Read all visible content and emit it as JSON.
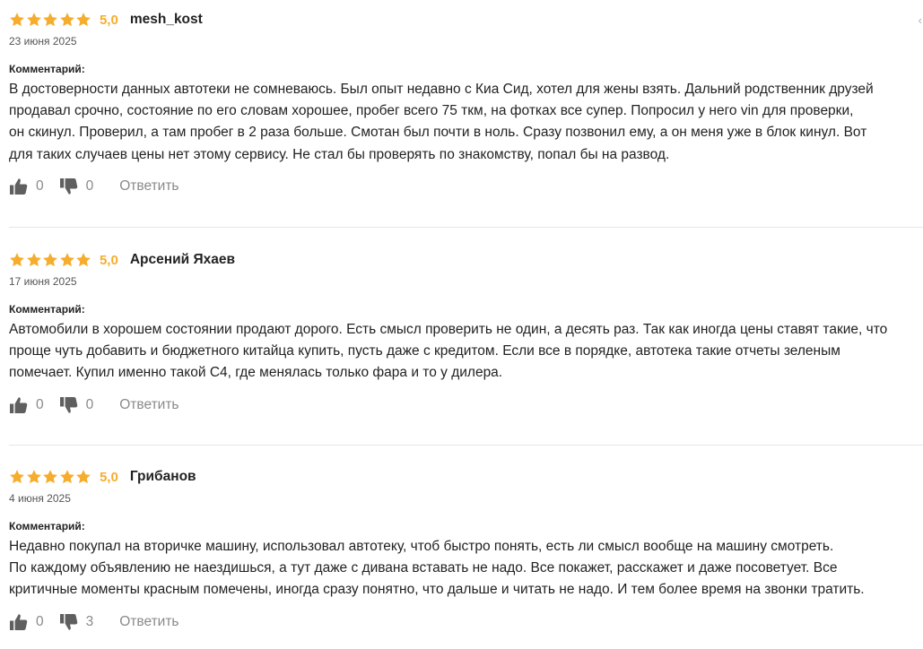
{
  "collapse_icon_glyph": "‹",
  "comment_label": "Комментарий:",
  "reply_label": "Ответить",
  "colors": {
    "star": "#f6ad2e",
    "score": "#f6ad2e",
    "muted": "#8a8a8a",
    "icon": "#5f5f5f"
  },
  "reviews": [
    {
      "rating": "5,0",
      "stars": 5,
      "author": "mesh_kost",
      "date": "23 июня 2025",
      "lines": [
        "В достоверности данных автотеки не сомневаюсь. Был опыт недавно с Киа Сид, хотел для жены взять. Дальний родственник друзей",
        "продавал срочно, состояние по его словам хорошее, пробег всего 75 ткм, на фотках все супер. Попросил у него vin для проверки,",
        "он скинул. Проверил, а там пробег в 2 раза больше. Смотан был почти в ноль. Сразу позвонил ему, а он меня уже в блок кинул. Вот",
        "для таких случаев цены нет этому сервису. Не стал бы проверять по знакомству, попал бы на развод."
      ],
      "likes": "0",
      "dislikes": "0"
    },
    {
      "rating": "5,0",
      "stars": 5,
      "author": "Арсений Яхаев",
      "date": "17 июня 2025",
      "lines": [
        "Автомобили в хорошем состоянии продают дорого. Есть смысл проверить не один, а десять раз. Так как иногда цены ставят такие, что",
        "проще чуть добавить и бюджетного китайца купить, пусть даже с кредитом. Если все в порядке, автотека такие отчеты зеленым",
        "помечает. Купил именно такой С4, где менялась только фара и то у дилера."
      ],
      "likes": "0",
      "dislikes": "0"
    },
    {
      "rating": "5,0",
      "stars": 5,
      "author": "Грибанов",
      "date": "4 июня 2025",
      "lines": [
        "Недавно покупал на вторичке машину, использовал автотеку, чтоб быстро понять, есть ли смысл вообще на машину смотреть.",
        "По каждому объявлению не наездишься, а тут даже с дивана вставать не надо. Все покажет, расскажет и даже посоветует. Все",
        "критичные моменты красным помечены, иногда сразу понятно, что дальше и читать не надо. И тем более время на звонки тратить."
      ],
      "likes": "0",
      "dislikes": "3"
    }
  ]
}
